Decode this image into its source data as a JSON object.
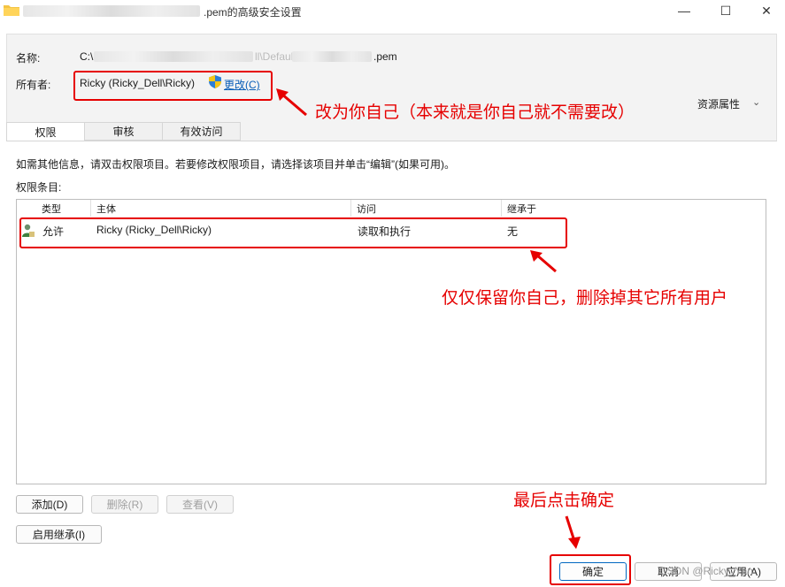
{
  "window": {
    "title_suffix": ".pem的高级安全设置",
    "minimize": "—",
    "maximize": "☐",
    "close": "✕"
  },
  "fields": {
    "name_label": "名称:",
    "name_prefix": "C:\\",
    "name_mid": "ll\\Default\\",
    "name_suffix": ".pem",
    "owner_label": "所有者:",
    "owner_value": "Ricky (Ricky_Dell\\Ricky)",
    "change_link": "更改(C)"
  },
  "resource_attributes": "资源属性",
  "tabs": [
    {
      "label": "权限",
      "active": true
    },
    {
      "label": "审核",
      "active": false
    },
    {
      "label": "有效访问",
      "active": false
    }
  ],
  "info_text": "如需其他信息，请双击权限项目。若要修改权限项目，请选择该项目并单击“编辑”(如果可用)。",
  "entries_label": "权限条目:",
  "table": {
    "headers": [
      "类型",
      "主体",
      "访问",
      "继承于"
    ],
    "rows": [
      {
        "type": "允许",
        "principal": "Ricky (Ricky_Dell\\Ricky)",
        "access": "读取和执行",
        "inherited": "无"
      }
    ]
  },
  "buttons": {
    "add": "添加(D)",
    "remove": "删除(R)",
    "view": "查看(V)",
    "enable_inherit": "启用继承(I)",
    "ok": "确定",
    "cancel": "取消",
    "apply": "应用(A)"
  },
  "annotations": {
    "owner_note": "改为你自己（本来就是你自己就不需要改）",
    "entries_note": "仅仅保留你自己，删除掉其它所有用户",
    "ok_note": "最后点击确定"
  },
  "watermark": "CSDN @Ricky_Yan",
  "colors": {
    "annotation_red": "#e60000",
    "link_blue": "#0b5fb8",
    "primary_border": "#0067c0"
  }
}
